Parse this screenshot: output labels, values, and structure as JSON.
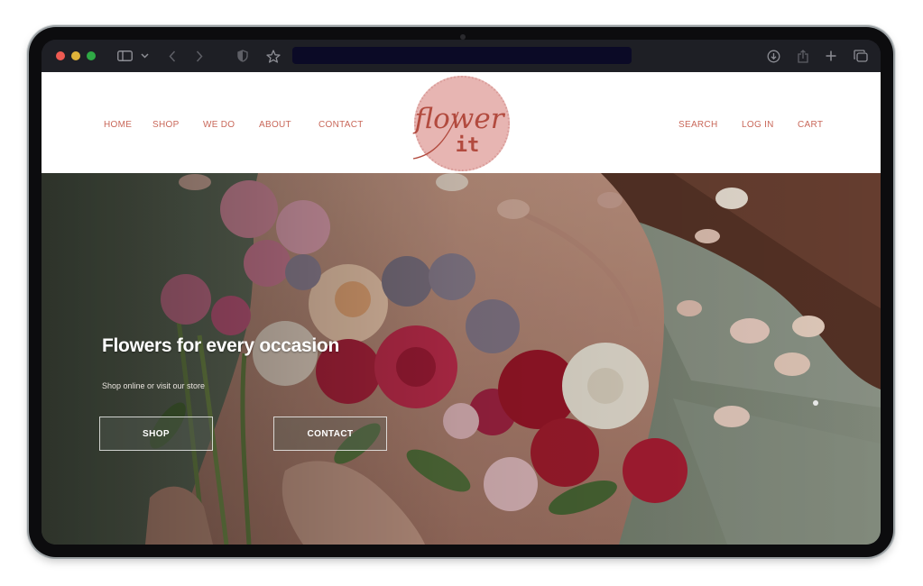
{
  "browser": {
    "toolbar_icons": [
      "sidebar-icon",
      "chevron-down-icon",
      "back-icon",
      "forward-icon",
      "shield-icon",
      "star-icon",
      "download-icon",
      "share-icon",
      "new-tab-icon",
      "tabs-icon"
    ],
    "address_value": ""
  },
  "site": {
    "nav_left": [
      "HOME",
      "SHOP",
      "WE DO",
      "ABOUT",
      "CONTACT"
    ],
    "nav_right": [
      "SEARCH",
      "LOG IN",
      "CART"
    ],
    "logo": {
      "word1": "flower",
      "word2": "it"
    },
    "colors": {
      "accent": "#c9685a",
      "logo_circle": "#e7b5b2"
    }
  },
  "hero": {
    "title": "Flowers for every occasion",
    "subtitle": "Shop online or visit our store",
    "buttons": [
      "SHOP",
      "CONTACT"
    ]
  }
}
